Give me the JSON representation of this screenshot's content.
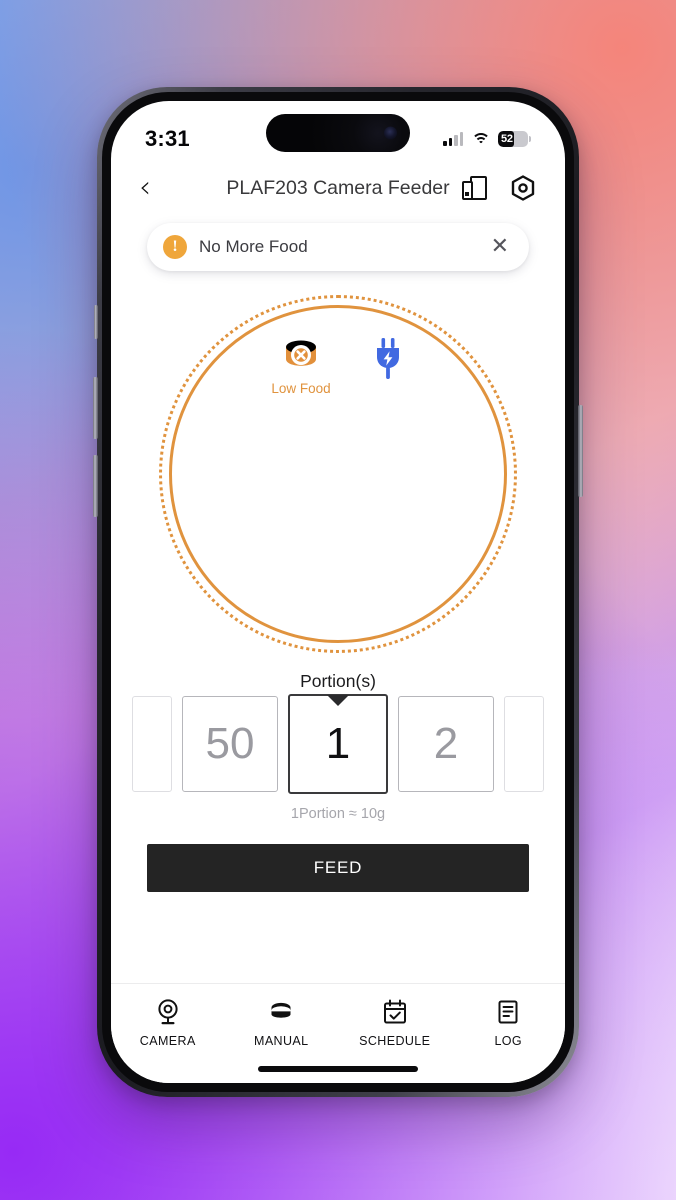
{
  "status_bar": {
    "time": "3:31",
    "battery_percent": "52",
    "battery_level": 52,
    "signal_icon": "cellular-signal-icon",
    "wifi_icon": "wifi-icon"
  },
  "nav": {
    "back_icon": "chevron-left-icon",
    "title": "PLAF203 Camera Feeder",
    "device_icon": "device-share-icon",
    "settings_icon": "hexagon-gear-icon"
  },
  "alert": {
    "warning_icon": "warning-exclamation-icon",
    "message": "No More Food",
    "close_icon": "close-x-icon",
    "accent": "#efa63b"
  },
  "bowl": {
    "low_food_icon": "food-bowl-x-icon",
    "low_food_label": "Low Food",
    "plug_icon": "power-plug-icon",
    "ring_color": "#e0933e",
    "plug_color": "#4169e1"
  },
  "portion": {
    "title": "Portion(s)",
    "hint": "1Portion ≈ 10g",
    "selected": "1",
    "options": [
      "",
      "50",
      "1",
      "2",
      ""
    ]
  },
  "feed": {
    "label": "FEED",
    "color": "#242424"
  },
  "tabs": [
    {
      "label": "CAMERA",
      "icon": "camera-icon",
      "active": false
    },
    {
      "label": "MANUAL",
      "icon": "bowl-icon",
      "active": true
    },
    {
      "label": "SCHEDULE",
      "icon": "calendar-check-icon",
      "active": false
    },
    {
      "label": "LOG",
      "icon": "document-lines-icon",
      "active": false
    }
  ]
}
